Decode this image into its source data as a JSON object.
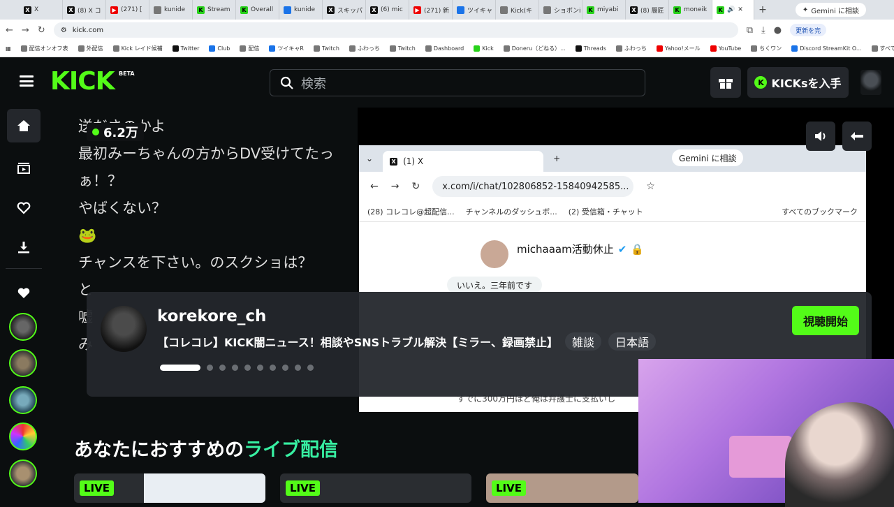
{
  "browser": {
    "tabs": [
      {
        "label": "X",
        "icon": "x"
      },
      {
        "label": "(8) X コ",
        "icon": "x"
      },
      {
        "label": "(271) [",
        "icon": "youtube"
      },
      {
        "label": "kunide",
        "icon": "other"
      },
      {
        "label": "Stream",
        "icon": "kick"
      },
      {
        "label": "Overall",
        "icon": "kick"
      },
      {
        "label": "kunide",
        "icon": "other"
      },
      {
        "label": "スキッパ",
        "icon": "x"
      },
      {
        "label": "(6) mic",
        "icon": "x"
      },
      {
        "label": "(271) 新",
        "icon": "youtube"
      },
      {
        "label": "ツイキャ",
        "icon": "other"
      },
      {
        "label": "Kick(キ",
        "icon": "other"
      },
      {
        "label": "ショボンi",
        "icon": "other"
      },
      {
        "label": "miyabi",
        "icon": "kick"
      },
      {
        "label": "(8) 履匠",
        "icon": "x"
      },
      {
        "label": "moneik",
        "icon": "kick"
      }
    ],
    "active_tab_icon": "kick",
    "gemini_label": "Gemini に相談",
    "url": "kick.com",
    "update_label": "更新を完",
    "bookmarks": [
      "配信オンオフ表",
      "外配信",
      "Kick レイド候補",
      "Twitter",
      "Club",
      "配信",
      "ツイキャR",
      "Twitch",
      "ふわっち",
      "Twitch",
      "Dashboard",
      "Kick",
      "Doneru（どねる）...",
      "Threads",
      "ふわっち",
      "Yahoo!メール",
      "YouTube",
      "ちくワン",
      "Discord StreamKit O...",
      "すべてのブ"
    ]
  },
  "kick": {
    "logo": "KICK",
    "logo_badge": "BETA",
    "search_placeholder": "検索",
    "kicks_button": "KICKsを入手",
    "chat_lines": [
      "送ださのかよ",
      "最初みーちゃんの方からDV受けてたっ",
      "ぁ！？",
      "やばくない？",
      "🐸",
      "チャンスを下さい。のスクショは？",
      "",
      "と",
      "嘘",
      "み"
    ],
    "viewer_count": "6.2万",
    "inner_browser": {
      "tab_label": "(1) X",
      "gemini_label": "Gemini に相談",
      "url": "x.com/i/chat/102806852-15840942585...",
      "bookmarks": [
        "(28) コレコレ@超配信...",
        "チャンネルのダッシュボ...",
        "(2) 受信箱・チャット",
        "すべてのブックマーク"
      ],
      "dm_name": "michaaam活動休止",
      "dm_message": "いいえ。三年前です",
      "dm_snippet": "すでに300万円ほど俺は弁護士に支払いし"
    },
    "featured": {
      "channel": "korekore_ch",
      "title": "【コレコレ】KICK闇ニュース！相談やSNSトラブル解決【ミラー、録画禁止】",
      "tags": [
        "雑談",
        "日本語"
      ],
      "watch_button": "視聴開始",
      "carousel_total": 10,
      "carousel_active": 1
    },
    "recommend_prefix": "あなたにおすすめの",
    "recommend_highlight": "ライブ配信",
    "live_badge": "LIVE",
    "accent": "#53fc18"
  }
}
